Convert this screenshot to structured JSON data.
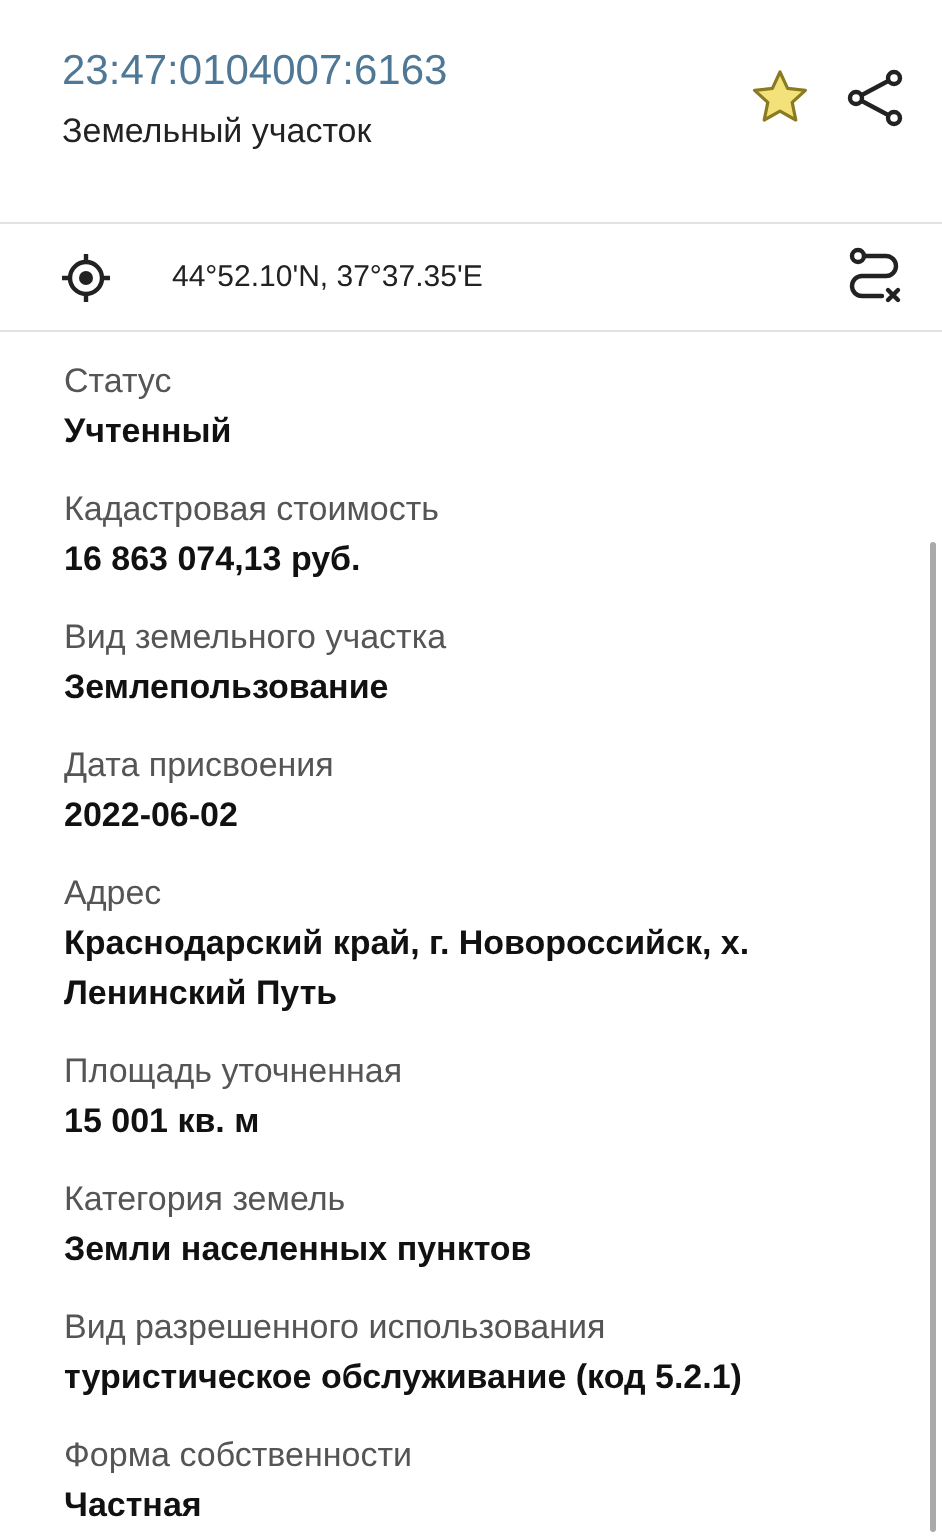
{
  "header": {
    "cadastral_number": "23:47:0104007:6163",
    "object_type": "Земельный участок",
    "favorite": true
  },
  "location": {
    "coordinates": "44°52.10'N, 37°37.35'E"
  },
  "fields": [
    {
      "label": "Статус",
      "value": "Учтенный"
    },
    {
      "label": "Кадастровая стоимость",
      "value": "16 863 074,13 руб."
    },
    {
      "label": "Вид земельного участка",
      "value": "Землепользование"
    },
    {
      "label": "Дата присвоения",
      "value": "2022-06-02"
    },
    {
      "label": "Адрес",
      "value": "Краснодарский край, г. Новороссийск, х. Ленинский Путь"
    },
    {
      "label": "Площадь уточненная",
      "value": "15 001 кв. м"
    },
    {
      "label": "Категория земель",
      "value": "Земли населенных пунктов"
    },
    {
      "label": "Вид разрешенного использования",
      "value": "туристическое обслуживание (код 5.2.1)"
    },
    {
      "label": "Форма собственности",
      "value": "Частная"
    }
  ]
}
